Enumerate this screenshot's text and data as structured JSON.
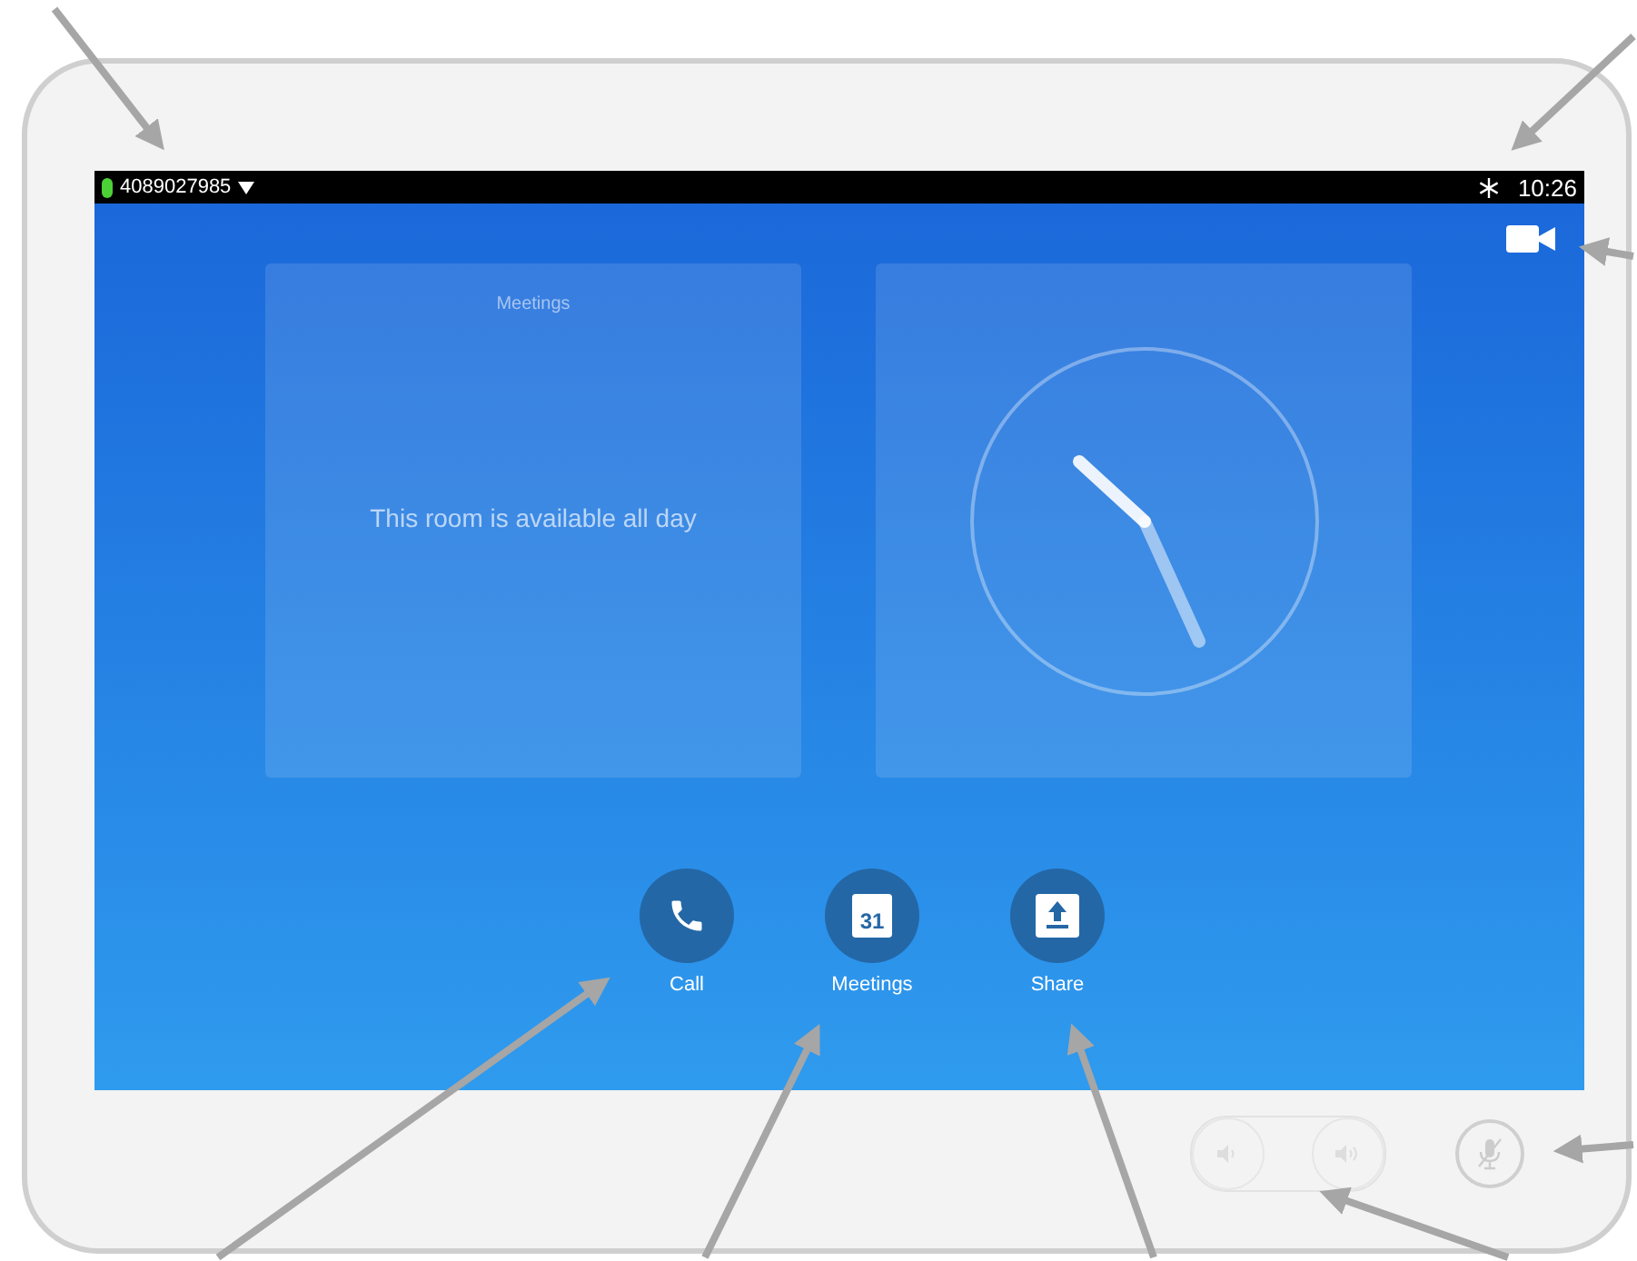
{
  "status_bar": {
    "number": "4089027985",
    "time": "10:26"
  },
  "meetings_panel": {
    "title": "Meetings",
    "message": "This room is available all day"
  },
  "actions": [
    {
      "kind": "call",
      "label": "Call"
    },
    {
      "kind": "calendar",
      "label": "Meetings",
      "day": "31"
    },
    {
      "kind": "share",
      "label": "Share"
    }
  ]
}
